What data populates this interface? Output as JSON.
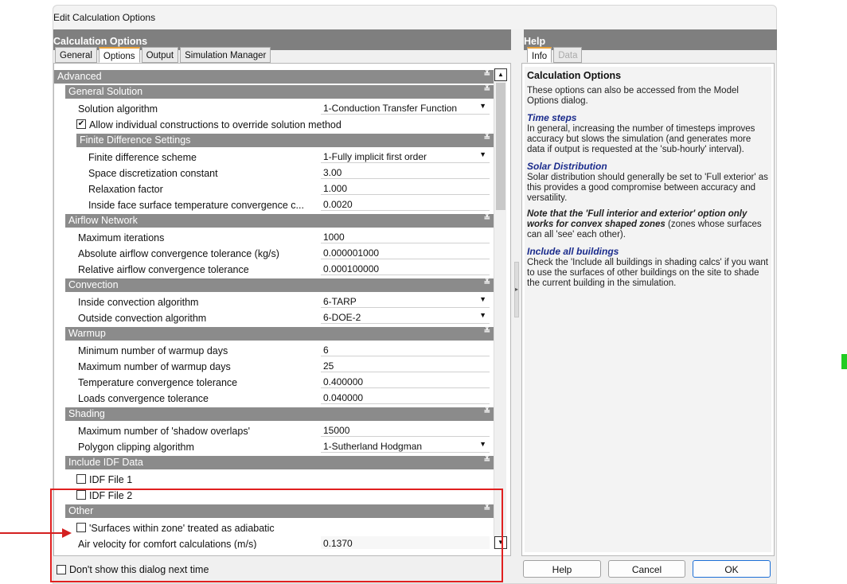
{
  "window": {
    "title": "Edit Calculation Options"
  },
  "left_header": "Calculation Options",
  "right_header": "Help",
  "tabs": [
    {
      "label": "General",
      "active": false
    },
    {
      "label": "Options",
      "active": true
    },
    {
      "label": "Output",
      "active": false
    },
    {
      "label": "Simulation Manager",
      "active": false
    }
  ],
  "help_tabs": [
    {
      "label": "Info",
      "active": true
    },
    {
      "label": "Data",
      "active": false,
      "disabled": true
    }
  ],
  "groups": {
    "advanced": "Advanced",
    "general_solution": "General Solution",
    "finite_difference": "Finite Difference Settings",
    "airflow": "Airflow Network",
    "convection": "Convection",
    "warmup": "Warmup",
    "shading": "Shading",
    "include_idf": "Include IDF Data",
    "other": "Other"
  },
  "fields": {
    "solution_algorithm": {
      "label": "Solution algorithm",
      "value": "1-Conduction Transfer Function"
    },
    "allow_override": {
      "label": "Allow individual constructions to override solution method",
      "checked": true
    },
    "fd_scheme": {
      "label": "Finite difference scheme",
      "value": "1-Fully implicit first order"
    },
    "space_disc": {
      "label": "Space discretization constant",
      "value": "3.00"
    },
    "relaxation": {
      "label": "Relaxation factor",
      "value": "1.000"
    },
    "inside_face": {
      "label": "Inside face surface temperature convergence c...",
      "value": "0.0020"
    },
    "max_iter": {
      "label": "Maximum iterations",
      "value": "1000"
    },
    "abs_airflow": {
      "label": "Absolute airflow convergence tolerance (kg/s)",
      "value": "0.000001000"
    },
    "rel_airflow": {
      "label": "Relative airflow convergence tolerance",
      "value": "0.000100000"
    },
    "inside_conv": {
      "label": "Inside convection algorithm",
      "value": "6-TARP"
    },
    "outside_conv": {
      "label": "Outside convection algorithm",
      "value": "6-DOE-2"
    },
    "min_warmup": {
      "label": "Minimum number of warmup days",
      "value": "6"
    },
    "max_warmup": {
      "label": "Maximum number of warmup days",
      "value": "25"
    },
    "temp_conv": {
      "label": "Temperature convergence tolerance",
      "value": "0.400000"
    },
    "loads_conv": {
      "label": "Loads convergence tolerance",
      "value": "0.040000"
    },
    "shadow_overlaps": {
      "label": "Maximum number of 'shadow overlaps'",
      "value": "15000"
    },
    "polygon_clip": {
      "label": "Polygon clipping algorithm",
      "value": "1-Sutherland Hodgman"
    },
    "idf1": {
      "label": "IDF File 1",
      "checked": false
    },
    "idf2": {
      "label": "IDF File 2",
      "checked": false
    },
    "adiabatic": {
      "label": "'Surfaces within zone' treated as adiabatic",
      "checked": false
    },
    "air_velocity": {
      "label": "Air velocity for comfort calculations (m/s)",
      "value": "0.1370"
    }
  },
  "help": {
    "title": "Calculation Options",
    "intro": "These options can also be accessed from the Model Options dialog.",
    "sec1_title": "Time steps",
    "sec1_text": "In general, increasing the number of timesteps improves accuracy but slows the simulation (and generates more data if output is requested at the 'sub-hourly' interval).",
    "sec2_title": "Solar Distribution",
    "sec2_text": "Solar distribution should generally be set to 'Full exterior' as this provides a good compromise between accuracy and versatility.",
    "note_bold": "Note that the 'Full interior and exterior' option only works for convex shaped zones",
    "note_rest": " (zones whose surfaces can all 'see' each other).",
    "sec3_title": "Include all buildings",
    "sec3_text": "Check the 'Include all buildings in shading calcs' if you want to use the surfaces of other buildings on the site to shade the current building in the simulation."
  },
  "footer": {
    "dont_show": "Don't show this dialog next time",
    "help_btn": "Help",
    "cancel_btn": "Cancel",
    "ok_btn": "OK"
  },
  "icons": {
    "collapse": "double-chevron-icon",
    "dropdown": "dropdown-arrow-icon"
  },
  "colors": {
    "group_header": "#8b8b8b",
    "annotation": "#e02020",
    "ok_border": "#1c6fd6"
  }
}
